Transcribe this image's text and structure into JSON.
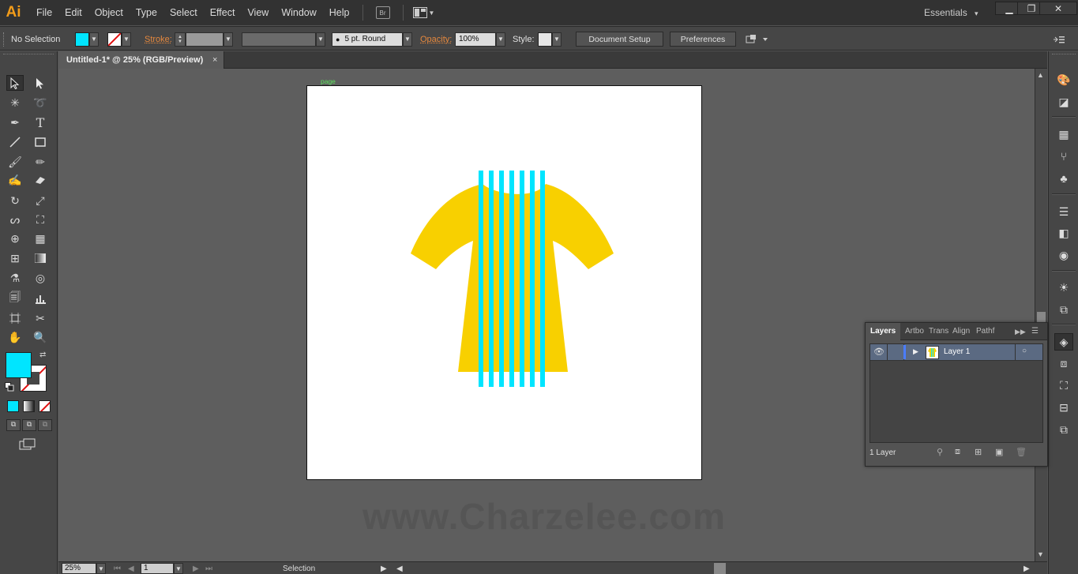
{
  "app": {
    "logo": "Ai"
  },
  "menu": [
    "File",
    "Edit",
    "Object",
    "Type",
    "Select",
    "Effect",
    "View",
    "Window",
    "Help"
  ],
  "menubar_icons": {
    "bridge": "Br",
    "arrange": "arrange-documents-icon"
  },
  "workspace": {
    "label": "Essentials",
    "arrow": "▾"
  },
  "window_controls": {
    "minimize": "▁",
    "restore": "❐",
    "close": "✕"
  },
  "control": {
    "selection_status": "No Selection",
    "fill_color": "#00e5ff",
    "stroke_label": "Stroke:",
    "brush_value": "5 pt. Round",
    "opacity_label": "Opacity:",
    "opacity_value": "100%",
    "style_label": "Style:",
    "document_setup": "Document Setup",
    "preferences": "Preferences"
  },
  "document": {
    "tab_title": "Untitled-1* @ 25% (RGB/Preview)",
    "close": "×"
  },
  "artboard": {
    "label": "page"
  },
  "colors": {
    "shirt": "#f8d000",
    "stripes": "#00e5ff",
    "accent_orange": "#e5883e"
  },
  "watermark": "www.Charzelee.com",
  "layers_panel": {
    "tabs": [
      "Layers",
      "Artbo",
      "Trans",
      "Align",
      "Pathf"
    ],
    "layer_name": "Layer 1",
    "count_label": "1 Layer"
  },
  "status": {
    "zoom": "25%",
    "page": "1",
    "tool": "Selection"
  }
}
